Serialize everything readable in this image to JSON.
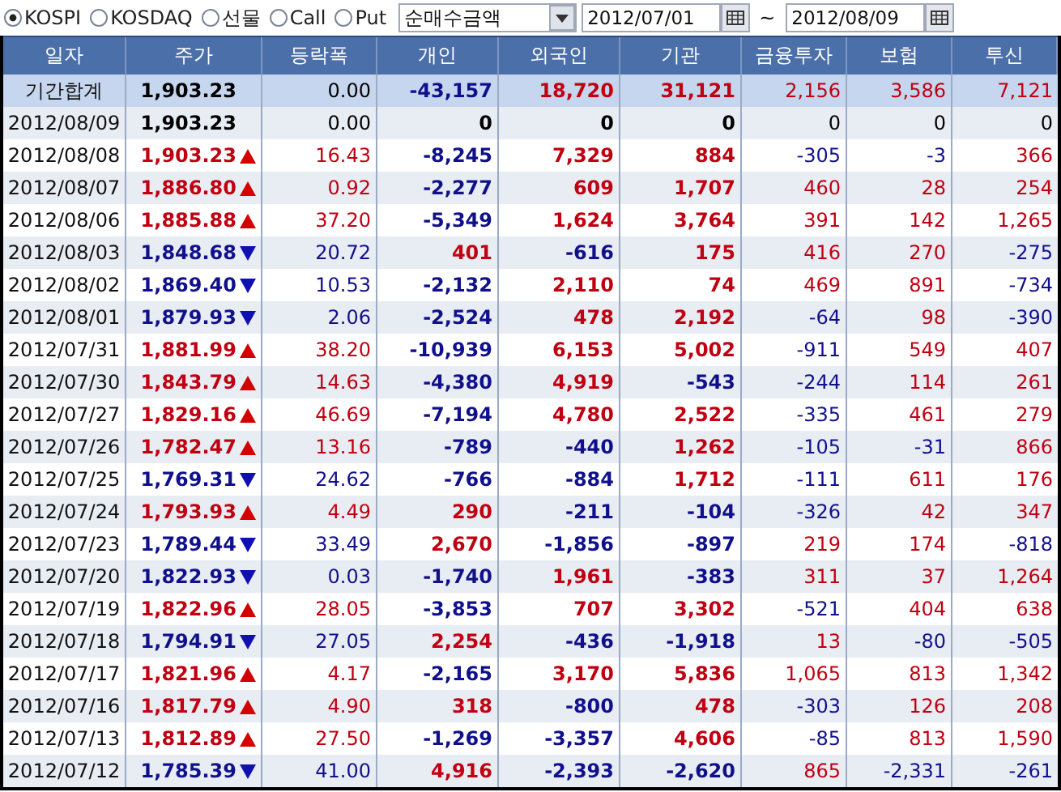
{
  "markets": [
    {
      "label": "KOSPI",
      "selected": true
    },
    {
      "label": "KOSDAQ",
      "selected": false
    },
    {
      "label": "선물",
      "selected": false
    },
    {
      "label": "Call",
      "selected": false
    },
    {
      "label": "Put",
      "selected": false
    }
  ],
  "measure": {
    "value": "순매수금액"
  },
  "date_from": {
    "value": "2012/07/01"
  },
  "range_sep": "~",
  "date_to": {
    "value": "2012/08/09"
  },
  "table": {
    "columns": [
      "일자",
      "주가",
      "등락폭",
      "개인",
      "외국인",
      "기관",
      "금융투자",
      "보험",
      "투신"
    ],
    "rows": [
      {
        "kind": "total",
        "date": "기간합계",
        "price": {
          "value": "1,903.23",
          "kind": "flat"
        },
        "change": "0.00",
        "flows": [
          {
            "value": "-43,157",
            "kind": "down"
          },
          {
            "value": "18,720",
            "kind": "up"
          },
          {
            "value": "31,121",
            "kind": "up"
          },
          {
            "value": "2,156",
            "kind": "up"
          },
          {
            "value": "3,586",
            "kind": "up"
          },
          {
            "value": "7,121",
            "kind": "up"
          }
        ]
      },
      {
        "kind": "day",
        "date": "2012/08/09",
        "price": {
          "value": "1,903.23",
          "kind": "flat"
        },
        "change": "0.00",
        "flows": [
          {
            "value": "0",
            "kind": "flat"
          },
          {
            "value": "0",
            "kind": "flat"
          },
          {
            "value": "0",
            "kind": "flat"
          },
          {
            "value": "0",
            "kind": "flat"
          },
          {
            "value": "0",
            "kind": "flat"
          },
          {
            "value": "0",
            "kind": "flat"
          }
        ]
      },
      {
        "kind": "day",
        "date": "2012/08/08",
        "price": {
          "value": "1,903.23",
          "kind": "up"
        },
        "change": "16.43",
        "flows": [
          {
            "value": "-8,245",
            "kind": "down"
          },
          {
            "value": "7,329",
            "kind": "up"
          },
          {
            "value": "884",
            "kind": "up"
          },
          {
            "value": "-305",
            "kind": "down"
          },
          {
            "value": "-3",
            "kind": "down"
          },
          {
            "value": "366",
            "kind": "up"
          }
        ]
      },
      {
        "kind": "day",
        "date": "2012/08/07",
        "price": {
          "value": "1,886.80",
          "kind": "up"
        },
        "change": "0.92",
        "flows": [
          {
            "value": "-2,277",
            "kind": "down"
          },
          {
            "value": "609",
            "kind": "up"
          },
          {
            "value": "1,707",
            "kind": "up"
          },
          {
            "value": "460",
            "kind": "up"
          },
          {
            "value": "28",
            "kind": "up"
          },
          {
            "value": "254",
            "kind": "up"
          }
        ]
      },
      {
        "kind": "day",
        "date": "2012/08/06",
        "price": {
          "value": "1,885.88",
          "kind": "up"
        },
        "change": "37.20",
        "flows": [
          {
            "value": "-5,349",
            "kind": "down"
          },
          {
            "value": "1,624",
            "kind": "up"
          },
          {
            "value": "3,764",
            "kind": "up"
          },
          {
            "value": "391",
            "kind": "up"
          },
          {
            "value": "142",
            "kind": "up"
          },
          {
            "value": "1,265",
            "kind": "up"
          }
        ]
      },
      {
        "kind": "day",
        "date": "2012/08/03",
        "price": {
          "value": "1,848.68",
          "kind": "down"
        },
        "change": "20.72",
        "flows": [
          {
            "value": "401",
            "kind": "up"
          },
          {
            "value": "-616",
            "kind": "down"
          },
          {
            "value": "175",
            "kind": "up"
          },
          {
            "value": "416",
            "kind": "up"
          },
          {
            "value": "270",
            "kind": "up"
          },
          {
            "value": "-275",
            "kind": "down"
          }
        ]
      },
      {
        "kind": "day",
        "date": "2012/08/02",
        "price": {
          "value": "1,869.40",
          "kind": "down"
        },
        "change": "10.53",
        "flows": [
          {
            "value": "-2,132",
            "kind": "down"
          },
          {
            "value": "2,110",
            "kind": "up"
          },
          {
            "value": "74",
            "kind": "up"
          },
          {
            "value": "469",
            "kind": "up"
          },
          {
            "value": "891",
            "kind": "up"
          },
          {
            "value": "-734",
            "kind": "down"
          }
        ]
      },
      {
        "kind": "day",
        "date": "2012/08/01",
        "price": {
          "value": "1,879.93",
          "kind": "down"
        },
        "change": "2.06",
        "flows": [
          {
            "value": "-2,524",
            "kind": "down"
          },
          {
            "value": "478",
            "kind": "up"
          },
          {
            "value": "2,192",
            "kind": "up"
          },
          {
            "value": "-64",
            "kind": "down"
          },
          {
            "value": "98",
            "kind": "up"
          },
          {
            "value": "-390",
            "kind": "down"
          }
        ]
      },
      {
        "kind": "day",
        "date": "2012/07/31",
        "price": {
          "value": "1,881.99",
          "kind": "up"
        },
        "change": "38.20",
        "flows": [
          {
            "value": "-10,939",
            "kind": "down"
          },
          {
            "value": "6,153",
            "kind": "up"
          },
          {
            "value": "5,002",
            "kind": "up"
          },
          {
            "value": "-911",
            "kind": "down"
          },
          {
            "value": "549",
            "kind": "up"
          },
          {
            "value": "407",
            "kind": "up"
          }
        ]
      },
      {
        "kind": "day",
        "date": "2012/07/30",
        "price": {
          "value": "1,843.79",
          "kind": "up"
        },
        "change": "14.63",
        "flows": [
          {
            "value": "-4,380",
            "kind": "down"
          },
          {
            "value": "4,919",
            "kind": "up"
          },
          {
            "value": "-543",
            "kind": "down"
          },
          {
            "value": "-244",
            "kind": "down"
          },
          {
            "value": "114",
            "kind": "up"
          },
          {
            "value": "261",
            "kind": "up"
          }
        ]
      },
      {
        "kind": "day",
        "date": "2012/07/27",
        "price": {
          "value": "1,829.16",
          "kind": "up"
        },
        "change": "46.69",
        "flows": [
          {
            "value": "-7,194",
            "kind": "down"
          },
          {
            "value": "4,780",
            "kind": "up"
          },
          {
            "value": "2,522",
            "kind": "up"
          },
          {
            "value": "-335",
            "kind": "down"
          },
          {
            "value": "461",
            "kind": "up"
          },
          {
            "value": "279",
            "kind": "up"
          }
        ]
      },
      {
        "kind": "day",
        "date": "2012/07/26",
        "price": {
          "value": "1,782.47",
          "kind": "up"
        },
        "change": "13.16",
        "flows": [
          {
            "value": "-789",
            "kind": "down"
          },
          {
            "value": "-440",
            "kind": "down"
          },
          {
            "value": "1,262",
            "kind": "up"
          },
          {
            "value": "-105",
            "kind": "down"
          },
          {
            "value": "-31",
            "kind": "down"
          },
          {
            "value": "866",
            "kind": "up"
          }
        ]
      },
      {
        "kind": "day",
        "date": "2012/07/25",
        "price": {
          "value": "1,769.31",
          "kind": "down"
        },
        "change": "24.62",
        "flows": [
          {
            "value": "-766",
            "kind": "down"
          },
          {
            "value": "-884",
            "kind": "down"
          },
          {
            "value": "1,712",
            "kind": "up"
          },
          {
            "value": "-111",
            "kind": "down"
          },
          {
            "value": "611",
            "kind": "up"
          },
          {
            "value": "176",
            "kind": "up"
          }
        ]
      },
      {
        "kind": "day",
        "date": "2012/07/24",
        "price": {
          "value": "1,793.93",
          "kind": "up"
        },
        "change": "4.49",
        "flows": [
          {
            "value": "290",
            "kind": "up"
          },
          {
            "value": "-211",
            "kind": "down"
          },
          {
            "value": "-104",
            "kind": "down"
          },
          {
            "value": "-326",
            "kind": "down"
          },
          {
            "value": "42",
            "kind": "up"
          },
          {
            "value": "347",
            "kind": "up"
          }
        ]
      },
      {
        "kind": "day",
        "date": "2012/07/23",
        "price": {
          "value": "1,789.44",
          "kind": "down"
        },
        "change": "33.49",
        "flows": [
          {
            "value": "2,670",
            "kind": "up"
          },
          {
            "value": "-1,856",
            "kind": "down"
          },
          {
            "value": "-897",
            "kind": "down"
          },
          {
            "value": "219",
            "kind": "up"
          },
          {
            "value": "174",
            "kind": "up"
          },
          {
            "value": "-818",
            "kind": "down"
          }
        ]
      },
      {
        "kind": "day",
        "date": "2012/07/20",
        "price": {
          "value": "1,822.93",
          "kind": "down"
        },
        "change": "0.03",
        "flows": [
          {
            "value": "-1,740",
            "kind": "down"
          },
          {
            "value": "1,961",
            "kind": "up"
          },
          {
            "value": "-383",
            "kind": "down"
          },
          {
            "value": "311",
            "kind": "up"
          },
          {
            "value": "37",
            "kind": "up"
          },
          {
            "value": "1,264",
            "kind": "up"
          }
        ]
      },
      {
        "kind": "day",
        "date": "2012/07/19",
        "price": {
          "value": "1,822.96",
          "kind": "up"
        },
        "change": "28.05",
        "flows": [
          {
            "value": "-3,853",
            "kind": "down"
          },
          {
            "value": "707",
            "kind": "up"
          },
          {
            "value": "3,302",
            "kind": "up"
          },
          {
            "value": "-521",
            "kind": "down"
          },
          {
            "value": "404",
            "kind": "up"
          },
          {
            "value": "638",
            "kind": "up"
          }
        ]
      },
      {
        "kind": "day",
        "date": "2012/07/18",
        "price": {
          "value": "1,794.91",
          "kind": "down"
        },
        "change": "27.05",
        "flows": [
          {
            "value": "2,254",
            "kind": "up"
          },
          {
            "value": "-436",
            "kind": "down"
          },
          {
            "value": "-1,918",
            "kind": "down"
          },
          {
            "value": "13",
            "kind": "up"
          },
          {
            "value": "-80",
            "kind": "down"
          },
          {
            "value": "-505",
            "kind": "down"
          }
        ]
      },
      {
        "kind": "day",
        "date": "2012/07/17",
        "price": {
          "value": "1,821.96",
          "kind": "up"
        },
        "change": "4.17",
        "flows": [
          {
            "value": "-2,165",
            "kind": "down"
          },
          {
            "value": "3,170",
            "kind": "up"
          },
          {
            "value": "5,836",
            "kind": "up"
          },
          {
            "value": "1,065",
            "kind": "up"
          },
          {
            "value": "813",
            "kind": "up"
          },
          {
            "value": "1,342",
            "kind": "up"
          }
        ]
      },
      {
        "kind": "day",
        "date": "2012/07/16",
        "price": {
          "value": "1,817.79",
          "kind": "up"
        },
        "change": "4.90",
        "flows": [
          {
            "value": "318",
            "kind": "up"
          },
          {
            "value": "-800",
            "kind": "down"
          },
          {
            "value": "478",
            "kind": "up"
          },
          {
            "value": "-303",
            "kind": "down"
          },
          {
            "value": "126",
            "kind": "up"
          },
          {
            "value": "208",
            "kind": "up"
          }
        ]
      },
      {
        "kind": "day",
        "date": "2012/07/13",
        "price": {
          "value": "1,812.89",
          "kind": "up"
        },
        "change": "27.50",
        "flows": [
          {
            "value": "-1,269",
            "kind": "down"
          },
          {
            "value": "-3,357",
            "kind": "down"
          },
          {
            "value": "4,606",
            "kind": "up"
          },
          {
            "value": "-85",
            "kind": "down"
          },
          {
            "value": "813",
            "kind": "up"
          },
          {
            "value": "1,590",
            "kind": "up"
          }
        ]
      },
      {
        "kind": "day",
        "date": "2012/07/12",
        "price": {
          "value": "1,785.39",
          "kind": "down"
        },
        "change": "41.00",
        "flows": [
          {
            "value": "4,916",
            "kind": "up"
          },
          {
            "value": "-2,393",
            "kind": "down"
          },
          {
            "value": "-2,620",
            "kind": "down"
          },
          {
            "value": "865",
            "kind": "up"
          },
          {
            "value": "-2,331",
            "kind": "down"
          },
          {
            "value": "-261",
            "kind": "down"
          }
        ]
      }
    ]
  }
}
